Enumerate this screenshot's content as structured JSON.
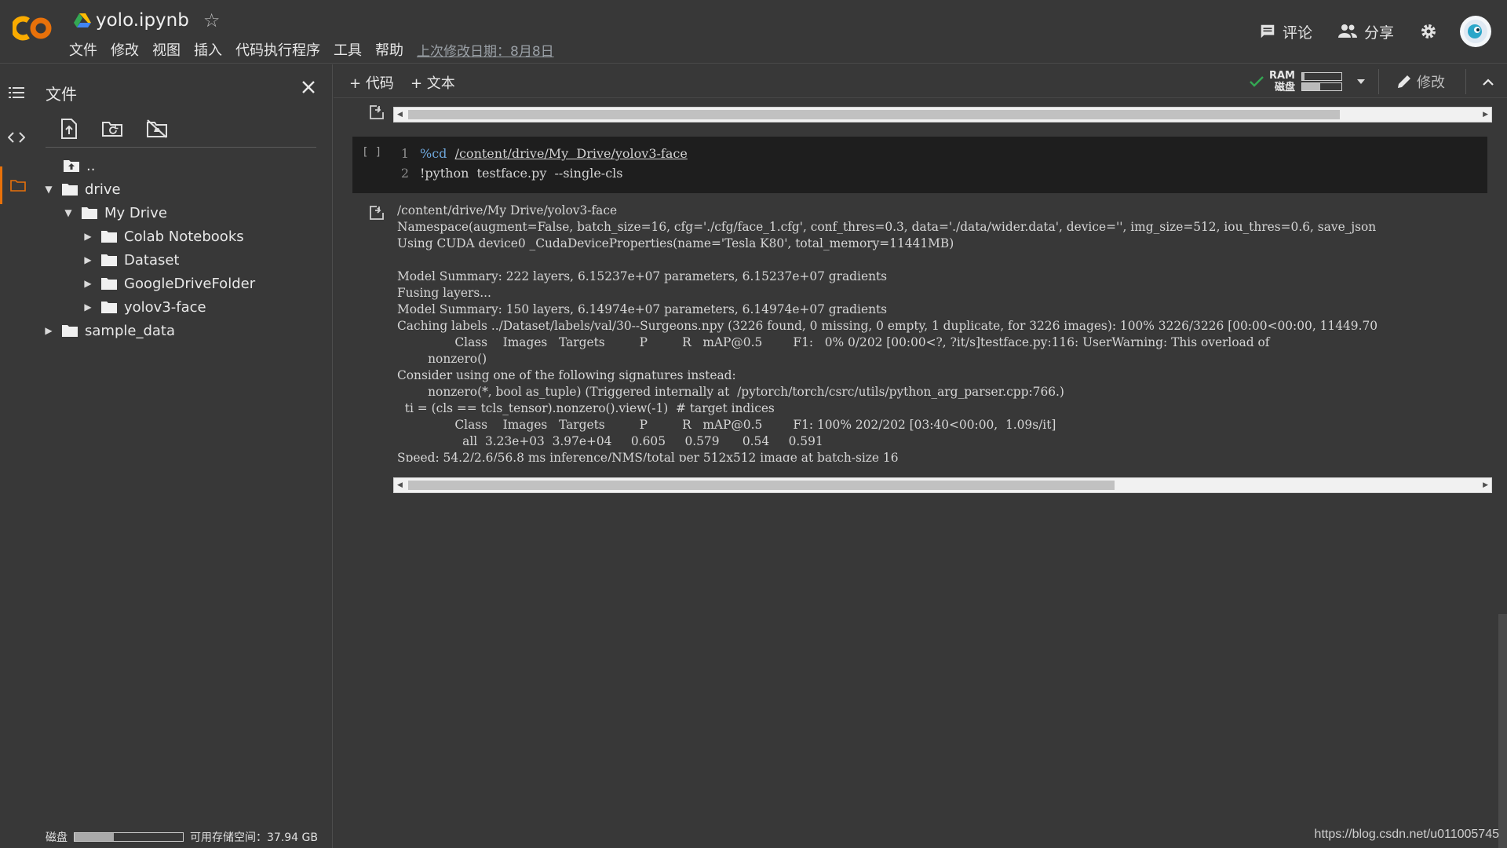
{
  "header": {
    "notebook_title": "yolo.ipynb",
    "menu": [
      "文件",
      "修改",
      "视图",
      "插入",
      "代码执行程序",
      "工具",
      "帮助"
    ],
    "last_modified": "上次修改日期：8月8日",
    "comment_label": "评论",
    "share_label": "分享"
  },
  "files_panel": {
    "title": "文件",
    "tree": {
      "parent": "..",
      "drive": "drive",
      "my_drive": "My Drive",
      "colab_notebooks": "Colab Notebooks",
      "dataset": "Dataset",
      "google_drive_folder": "GoogleDriveFolder",
      "yolov3_face": "yolov3-face",
      "sample_data": "sample_data"
    },
    "disk_label": "磁盘",
    "disk_used_fraction": 0.36,
    "storage_label": "可用存储空间：37.94 GB"
  },
  "toolbar": {
    "add_code": "+ 代码",
    "add_text": "+ 文本",
    "ram_label": "RAM",
    "disk_label": "磁盘",
    "ram_fraction": 0.05,
    "disk_fraction": 0.45,
    "edit_label": "修改"
  },
  "top_scroll": {
    "thumb_fraction": 0.87
  },
  "code_cell": {
    "run_bracket": "[ ]",
    "line1_num": "1",
    "line1_magic": "%cd",
    "line1_path": "/content/drive/My  Drive/yolov3-face",
    "line2_num": "2",
    "line2_code": "!python  testface.py  --single-cls"
  },
  "output": {
    "lines": [
      "/content/drive/My Drive/yolov3-face",
      "Namespace(augment=False, batch_size=16, cfg='./cfg/face_1.cfg', conf_thres=0.3, data='./data/wider.data', device='', img_size=512, iou_thres=0.6, save_json",
      "Using CUDA device0 _CudaDeviceProperties(name='Tesla K80', total_memory=11441MB)",
      "",
      "Model Summary: 222 layers, 6.15237e+07 parameters, 6.15237e+07 gradients",
      "Fusing layers...",
      "Model Summary: 150 layers, 6.14974e+07 parameters, 6.14974e+07 gradients",
      "Caching labels ../Dataset/labels/val/30--Surgeons.npy (3226 found, 0 missing, 0 empty, 1 duplicate, for 3226 images): 100% 3226/3226 [00:00<00:00, 11449.70",
      "               Class    Images   Targets         P         R   mAP@0.5        F1:   0% 0/202 [00:00<?, ?it/s]testface.py:116: UserWarning: This overload of",
      "        nonzero()",
      "Consider using one of the following signatures instead:",
      "        nonzero(*, bool as_tuple) (Triggered internally at  /pytorch/torch/csrc/utils/python_arg_parser.cpp:766.)",
      "  ti = (cls == tcls_tensor).nonzero().view(-1)  # target indices",
      "               Class    Images   Targets         P         R   mAP@0.5        F1: 100% 202/202 [03:40<00:00,  1.09s/it]",
      "                 all  3.23e+03  3.97e+04     0.605     0.579      0.54     0.591",
      "Speed: 54.2/2.6/56.8 ms inference/NMS/total per 512x512 image at batch-size 16"
    ]
  },
  "bottom_scroll": {
    "thumb_fraction": 0.66
  },
  "watermark": "https://blog.csdn.net/u011005745"
}
